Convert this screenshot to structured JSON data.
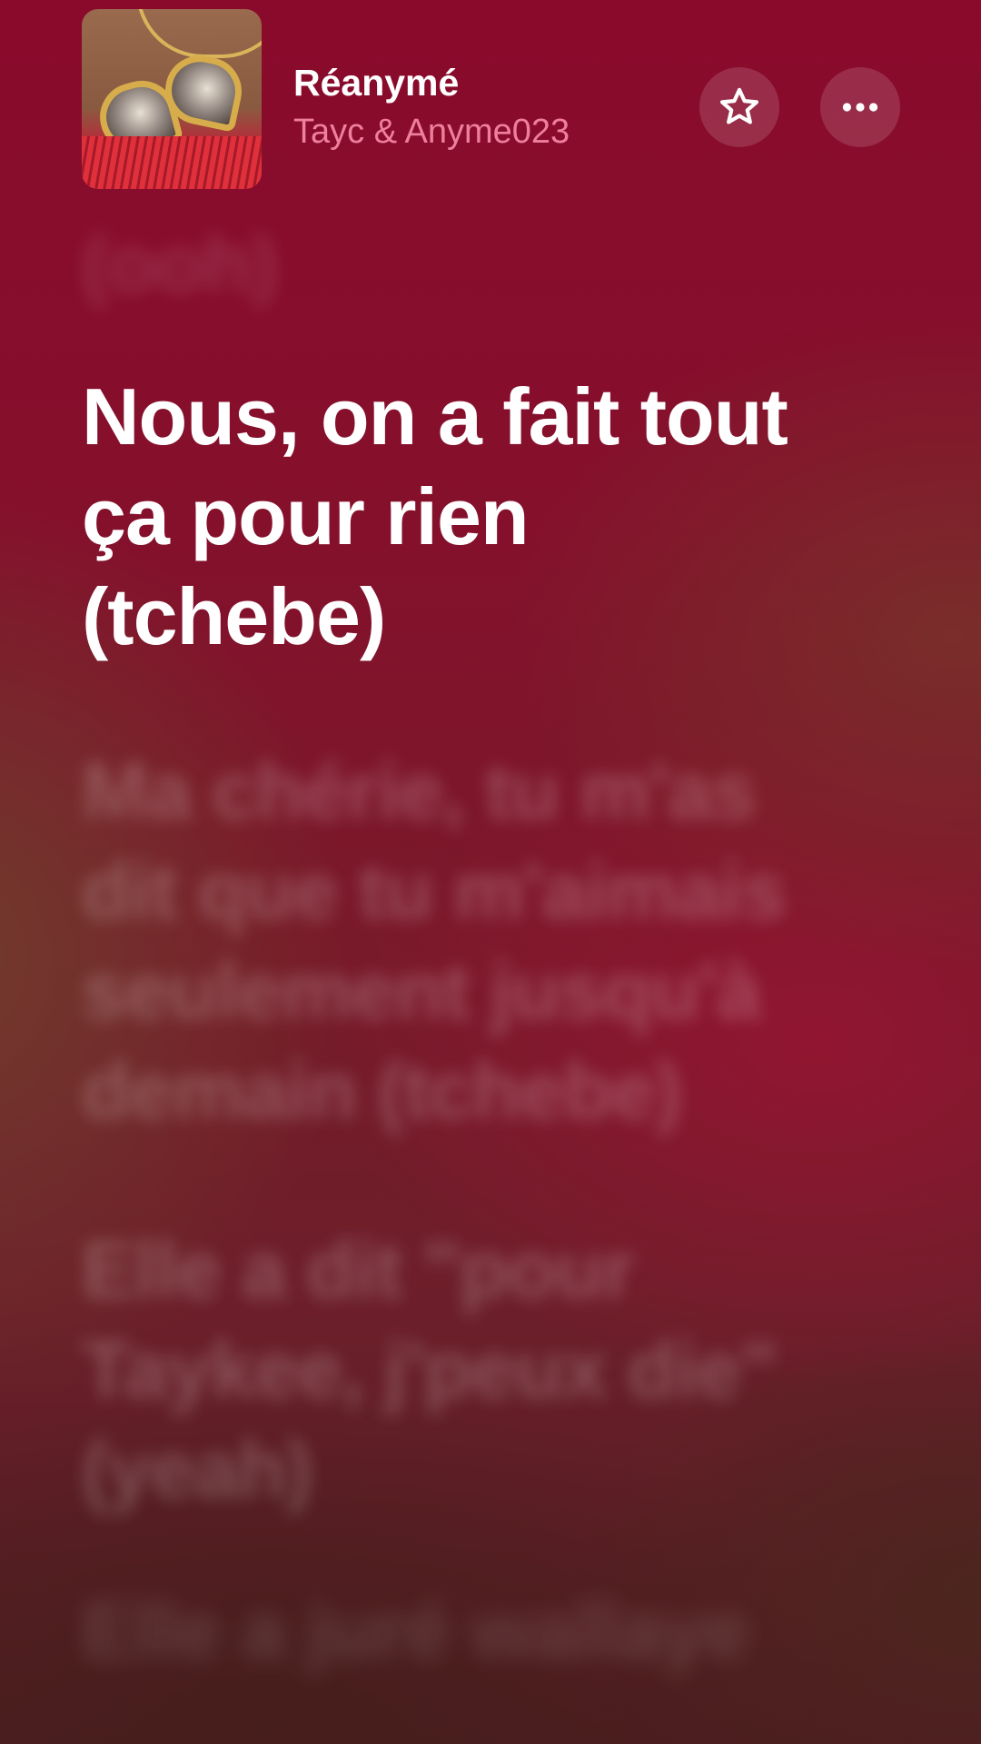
{
  "now_playing": {
    "title": "Réanymé",
    "artist": "Tayc & Anyme023"
  },
  "header_actions": {
    "favorite_icon": "star-icon",
    "more_icon": "ellipsis-icon"
  },
  "lyrics": {
    "previous_line": "(ooh)",
    "current_line": "Nous, on a fait tout\nça pour rien\n(tchebe)",
    "upcoming_lines": [
      "Ma chérie, tu m'as\ndit que tu m'aimais\nseulement jusqu'à\ndemain (tchebe)",
      "Elle a dit \"pour\nTaykee, j'peux die\"\n(yeah)",
      "Elle a juré wallaye"
    ]
  },
  "colors": {
    "background_top": "#8a0a2c",
    "background_bottom": "#4e1d20",
    "artist_pink": "#ee7f9d",
    "active_lyric": "#ffffff"
  }
}
